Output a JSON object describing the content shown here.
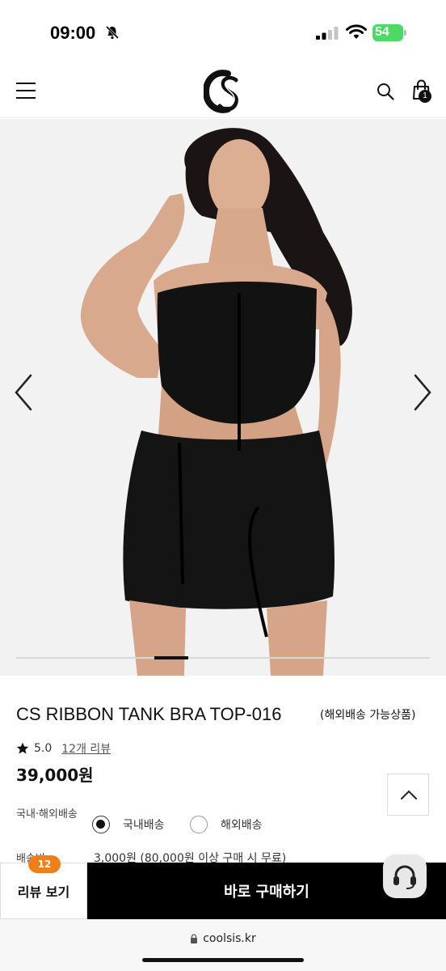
{
  "status_bar": {
    "time": "09:00",
    "battery": "54"
  },
  "header": {
    "logo": "CS",
    "cart_count": "1"
  },
  "product": {
    "title": "CS RIBBON TANK BRA TOP-016",
    "title_note": "(해외배송 가능상품)",
    "rating": "5.0",
    "review_link": "12개 리뷰",
    "price": "39,000원"
  },
  "shipping": {
    "label": "국내·해외배송",
    "options": [
      {
        "label": "국내배송",
        "selected": true
      },
      {
        "label": "해외배송",
        "selected": false
      }
    ],
    "fee_label": "배송비",
    "fee_value": "3,000원 (80,000원 이상 구매 시 무료)"
  },
  "bottom_bar": {
    "review_button": "리뷰 보기",
    "review_count": "12",
    "buy_button": "바로 구매하기"
  },
  "browser": {
    "url": "coolsis.kr"
  },
  "colors": {
    "accent": "#f07f1a",
    "buy": "#000000",
    "battery": "#4cd964"
  }
}
